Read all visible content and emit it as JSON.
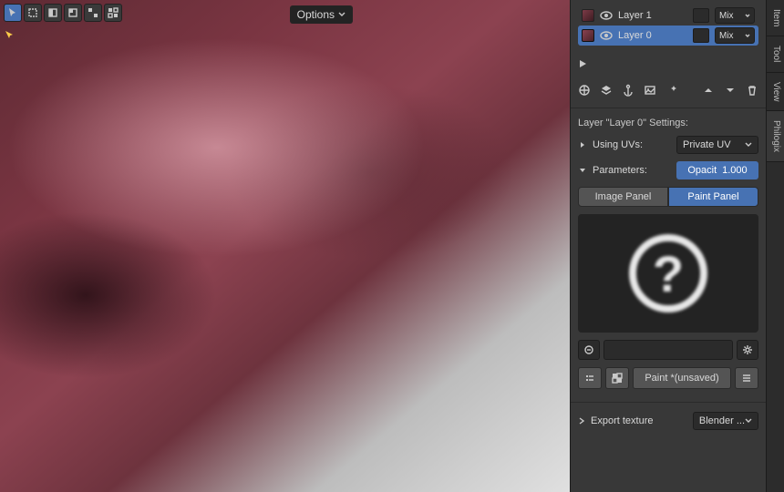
{
  "header": {
    "options_label": "Options"
  },
  "layers": {
    "items": [
      {
        "name": "Layer 1",
        "blend": "Mix",
        "visible": true,
        "selected": false
      },
      {
        "name": "Layer 0",
        "blend": "Mix",
        "visible": true,
        "selected": true
      }
    ],
    "settings_title": "Layer \"Layer 0\" Settings:"
  },
  "uv": {
    "label": "Using UVs:",
    "value": "Private UV"
  },
  "params": {
    "label": "Parameters:",
    "opacity_label": "Opacit",
    "opacity_value": "1.000",
    "image_panel": "Image Panel",
    "paint_panel": "Paint Panel",
    "active_panel": "paint"
  },
  "paint_slot": {
    "label": "Paint *(unsaved)"
  },
  "export": {
    "label": "Export texture",
    "format": "Blender ..."
  },
  "side_tabs": {
    "items": [
      "Item",
      "Tool",
      "View",
      "Philogix"
    ],
    "active": "Philogix"
  },
  "icons": {
    "toolbar": [
      "cursor",
      "select-box",
      "lasso",
      "circle",
      "tweak",
      "annotate"
    ],
    "layer_ops": [
      "move-tool",
      "layer-icon",
      "anchor",
      "image",
      "magic",
      "chevron-up",
      "chevron-down",
      "trash"
    ]
  },
  "colors": {
    "accent": "#4772b3",
    "panel": "#383838",
    "dark": "#2b2b2b"
  }
}
